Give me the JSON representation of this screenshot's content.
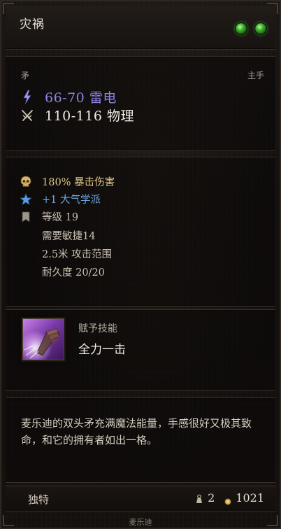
{
  "item": {
    "name": "灾祸",
    "weapon_type": "矛",
    "slot": "主手",
    "damage": [
      {
        "icon": "lightning-icon",
        "text": "66-70 雷电",
        "color": "#8d86e6"
      },
      {
        "icon": "crossed-swords-icon",
        "text": "110-116 物理",
        "color": "#f1ece4"
      }
    ],
    "stats": {
      "crit": "180% 暴击伤害",
      "school": "+1 大气学派",
      "level": "等级 19",
      "requirement": "需要敏捷14",
      "range": "2.5米 攻击范围",
      "durability": "耐久度 20/20"
    },
    "skill": {
      "label": "赋予技能",
      "name": "全力一击",
      "icon": "fist-skill-icon"
    },
    "description": "麦乐迪的双头矛充满魔法能量，手感很好又极其致命，和它的拥有者如出一格。",
    "footer": {
      "rarity": "独特",
      "weight": "2",
      "value": "1021"
    },
    "owner": "麦乐迪"
  },
  "colors": {
    "lightning": "#8d86e6",
    "crit": "#e0c586",
    "school": "#6fa6df",
    "gem": "#3fae2c"
  }
}
